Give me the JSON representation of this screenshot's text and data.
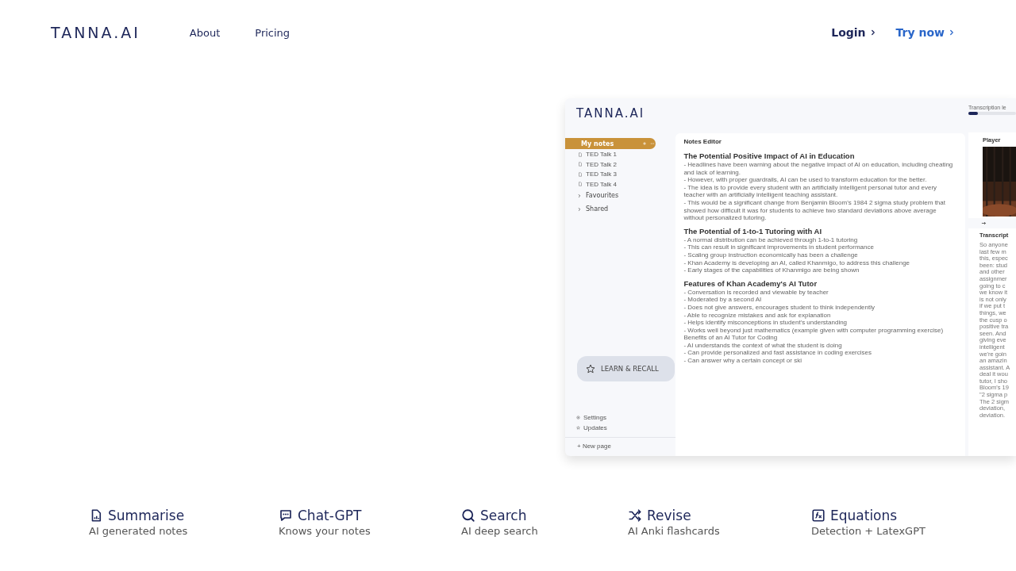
{
  "nav": {
    "logo": "TANNA.AI",
    "links": [
      {
        "label": "About"
      },
      {
        "label": "Pricing"
      }
    ],
    "actions": [
      {
        "label": "Login",
        "kind": "plain"
      },
      {
        "label": "Try now",
        "kind": "accent"
      }
    ]
  },
  "app": {
    "logo": "TANNA.AI",
    "sidebar": {
      "notes_folder": {
        "label": "My notes",
        "selected": true,
        "children": [
          {
            "label": "TED Talk 1"
          },
          {
            "label": "TED Talk 2"
          },
          {
            "label": "TED Talk 3"
          },
          {
            "label": "TED Talk 4"
          }
        ]
      },
      "folders": [
        {
          "label": "Favourites",
          "expanded": false
        },
        {
          "label": "Shared",
          "expanded": false
        }
      ],
      "learn_button": "LEARN & RECALL",
      "footer_links": [
        {
          "label": "Settings",
          "kind": "settings"
        },
        {
          "label": "Updates",
          "kind": "updates"
        }
      ],
      "new_page": "+ New page"
    },
    "editor": {
      "title": "Notes Editor",
      "blocks": [
        {
          "kind": "heading",
          "text": "The Potential Positive Impact of AI in Education"
        },
        {
          "kind": "line",
          "text": "- Headlines have been warning about the negative impact of AI on education, including cheating and lack of learning."
        },
        {
          "kind": "line",
          "text": "- However, with proper guardrails, AI can be used to transform education for the better."
        },
        {
          "kind": "line",
          "text": "- The idea is to provide every student with an artificially intelligent personal tutor and every teacher with an artificially intelligent teaching assistant."
        },
        {
          "kind": "line",
          "text": "- This would be a significant change from Benjamin Bloom's 1984 2 sigma study problem that showed how difficult it was for students to achieve two standard deviations above average without personalized tutoring."
        },
        {
          "kind": "heading",
          "text": "The Potential of 1-to-1 Tutoring with AI"
        },
        {
          "kind": "line",
          "text": "- A normal distribution can be achieved through 1-to-1 tutoring"
        },
        {
          "kind": "line",
          "text": "- This can result in significant improvements in student performance"
        },
        {
          "kind": "line",
          "text": "- Scaling group instruction economically has been a challenge"
        },
        {
          "kind": "line",
          "text": "- Khan Academy is developing an AI, called Khanmigo, to address this challenge"
        },
        {
          "kind": "line",
          "text": "- Early stages of the capabilities of Khanmigo are being shown"
        },
        {
          "kind": "heading",
          "text": "Features of Khan Academy's AI Tutor"
        },
        {
          "kind": "line",
          "text": "- Conversation is recorded and viewable by teacher"
        },
        {
          "kind": "line",
          "text": "- Moderated by a second AI"
        },
        {
          "kind": "line",
          "text": "- Does not give answers, encourages student to think independently"
        },
        {
          "kind": "line",
          "text": "- Able to recognize mistakes and ask for explanation"
        },
        {
          "kind": "line",
          "text": "- Helps identify misconceptions in student's understanding"
        },
        {
          "kind": "line",
          "text": "- Works well beyond just mathematics (example given with computer programming exercise)"
        },
        {
          "kind": "line",
          "text": "Benefits of an AI Tutor for Coding"
        },
        {
          "kind": "line",
          "text": "- AI understands the context of what the student is doing"
        },
        {
          "kind": "line",
          "text": "- Can provide personalized and fast assistance in coding exercises"
        },
        {
          "kind": "line",
          "text": "- Can answer why a certain concept or ski"
        }
      ]
    },
    "transcription": {
      "label": "Transcription le",
      "level": 0.2
    },
    "player": {
      "title": "Player"
    },
    "transcript": {
      "title": "Transcript",
      "lines": [
        "So anyone",
        "last few m",
        "this, espec",
        "been: stud",
        "and other",
        "assignmer",
        "going to c",
        "we know it",
        "is not only",
        "if we put t",
        "things, we",
        "the cusp o",
        "positive tra",
        "seen. And",
        "giving eve",
        "intelligent",
        "we're goin",
        "an amazin",
        "assistant. A",
        "deal it wou",
        "tutor, I sho",
        "Bloom's 19",
        "\"2 sigma p",
        "The 2 sigm",
        "deviation,",
        "deviation."
      ]
    }
  },
  "features": [
    {
      "kind": "summarise",
      "title": "Summarise",
      "subtitle": "AI generated notes"
    },
    {
      "kind": "chat",
      "title": "Chat-GPT",
      "subtitle": "Knows your notes"
    },
    {
      "kind": "search",
      "title": "Search",
      "subtitle": "AI deep search"
    },
    {
      "kind": "revise",
      "title": "Revise",
      "subtitle": "AI Anki flashcards"
    },
    {
      "kind": "equations",
      "title": "Equations",
      "subtitle": "Detection + LatexGPT"
    }
  ]
}
